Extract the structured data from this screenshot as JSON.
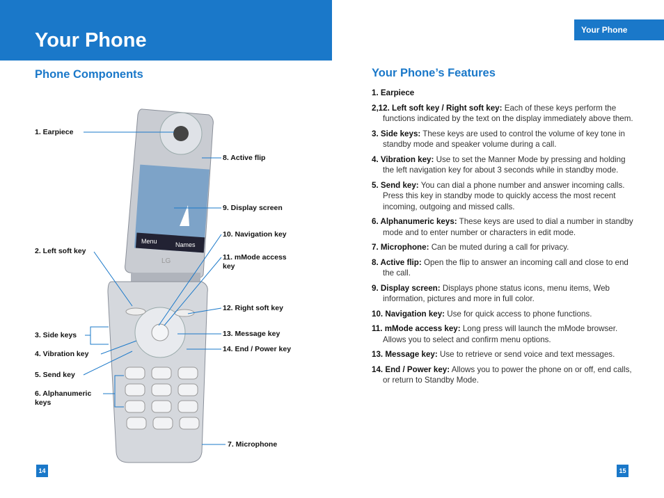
{
  "header": {
    "title": "Your Phone",
    "tab": "Your Phone"
  },
  "left": {
    "heading": "Phone Components",
    "labels": [
      "1. Earpiece",
      "2. Left soft key",
      "3. Side keys",
      "4. Vibration key",
      "5. Send key",
      "6. Alphanumeric keys",
      "7. Microphone",
      "8. Active flip",
      "9. Display screen",
      "10. Navigation key",
      "11. mMode access key",
      "12. Right soft key",
      "13. Message key",
      "14. End / Power key"
    ],
    "screen": {
      "left_soft": "Menu",
      "right_soft": "Names",
      "brand": "LG"
    },
    "page": "14"
  },
  "right": {
    "heading": "Your Phone’s Features",
    "items": [
      {
        "term": "1. Earpiece",
        "desc": ""
      },
      {
        "term": "2,12. Left soft key / Right soft key:",
        "desc": "Each of these keys perform the functions indicated by the text on the display immediately above them."
      },
      {
        "term": "3. Side keys:",
        "desc": "These keys are used to control the volume of key tone in standby mode and speaker volume during a call."
      },
      {
        "term": "4. Vibration key:",
        "desc": "Use to set the Manner Mode by pressing and holding the left navigation key for about 3 seconds while in standby mode."
      },
      {
        "term": "5. Send key:",
        "desc": "You can dial a phone number and answer incoming calls. Press this key in standby mode to quickly access the most recent incoming, outgoing and missed calls."
      },
      {
        "term": "6. Alphanumeric keys:",
        "desc": "These keys are used to dial a number in standby mode and to enter number or characters in edit mode."
      },
      {
        "term": "7. Microphone:",
        "desc": "Can be muted during a call for privacy."
      },
      {
        "term": "8. Active flip:",
        "desc": "Open the flip to answer an incoming call and close to end the call."
      },
      {
        "term": "9. Display screen:",
        "desc": "Displays phone status icons, menu items, Web information, pictures and more in full color."
      },
      {
        "term": "10. Navigation key:",
        "desc": "Use for quick access to phone functions."
      },
      {
        "term": "11. mMode access key:",
        "desc": "Long press will launch the mMode browser. Allows you to select and confirm menu options."
      },
      {
        "term": "13. Message key:",
        "desc": "Use to retrieve or send voice and text messages."
      },
      {
        "term": "14. End / Power key:",
        "desc": "Allows you to power the phone on or off, end calls, or return to Standby Mode."
      }
    ],
    "page": "15"
  },
  "colors": {
    "accent": "#1a78c9"
  }
}
